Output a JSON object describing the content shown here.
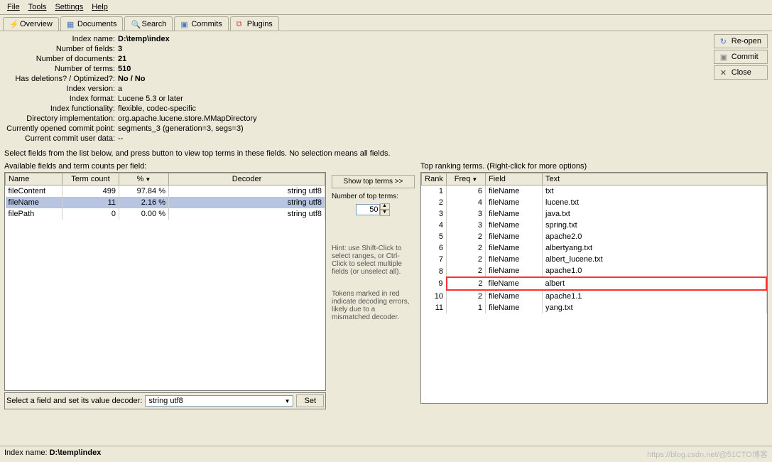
{
  "menu": [
    "File",
    "Tools",
    "Settings",
    "Help"
  ],
  "tabs": [
    {
      "label": "Overview",
      "icon": "lightning-icon",
      "active": true
    },
    {
      "label": "Documents",
      "icon": "documents-icon"
    },
    {
      "label": "Search",
      "icon": "search-icon"
    },
    {
      "label": "Commits",
      "icon": "commits-icon"
    },
    {
      "label": "Plugins",
      "icon": "plugins-icon"
    }
  ],
  "buttons": {
    "reopen": "Re-open",
    "commit": "Commit",
    "close": "Close"
  },
  "info": [
    {
      "label": "Index name:",
      "value": "D:\\temp\\index",
      "bold": true
    },
    {
      "label": "Number of fields:",
      "value": "3",
      "bold": true
    },
    {
      "label": "Number of documents:",
      "value": "21",
      "bold": true
    },
    {
      "label": "Number of terms:",
      "value": "510",
      "bold": true
    },
    {
      "label": "Has deletions? / Optimized?:",
      "value": "No / No",
      "bold": true
    },
    {
      "label": "Index version:",
      "value": "a",
      "bold": false
    },
    {
      "label": "Index format:",
      "value": "Lucene 5.3 or later",
      "bold": false
    },
    {
      "label": "Index functionality:",
      "value": "flexible, codec-specific",
      "bold": false
    },
    {
      "label": "Directory implementation:",
      "value": "org.apache.lucene.store.MMapDirectory",
      "bold": false
    },
    {
      "label": "Currently opened commit point:",
      "value": "segments_3 (generation=3, segs=3)",
      "bold": false
    },
    {
      "label": "Current commit user data:",
      "value": "--",
      "bold": false
    }
  ],
  "instruction": "Select fields from the list below, and press button to view top terms in these fields. No selection means all fields.",
  "leftPanel": {
    "title": "Available fields and term counts per field:",
    "headers": [
      "Name",
      "Term count",
      "%",
      "Decoder"
    ],
    "rows": [
      {
        "name": "fileContent",
        "count": "499",
        "pct": "97.84 %",
        "decoder": "string utf8",
        "selected": false
      },
      {
        "name": "fileName",
        "count": "11",
        "pct": "2.16 %",
        "decoder": "string utf8",
        "selected": true
      },
      {
        "name": "filePath",
        "count": "0",
        "pct": "0.00 %",
        "decoder": "string utf8",
        "selected": false
      }
    ]
  },
  "midPanel": {
    "showBtn": "Show top terms >>",
    "numLabel": "Number of top terms:",
    "numValue": "50",
    "hint1": "Hint: use Shift-Click to select ranges, or Ctrl-Click to select multiple fields (or unselect all).",
    "hint2": "Tokens marked in red indicate decoding errors, likely due to a mismatched decoder."
  },
  "rightPanel": {
    "title": "Top ranking terms. (Right-click for more options)",
    "headers": [
      "Rank",
      "Freq",
      "Field",
      "Text"
    ],
    "rows": [
      {
        "rank": "1",
        "freq": "6",
        "field": "fileName",
        "text": "txt"
      },
      {
        "rank": "2",
        "freq": "4",
        "field": "fileName",
        "text": "lucene.txt"
      },
      {
        "rank": "3",
        "freq": "3",
        "field": "fileName",
        "text": "java.txt"
      },
      {
        "rank": "4",
        "freq": "3",
        "field": "fileName",
        "text": "spring.txt"
      },
      {
        "rank": "5",
        "freq": "2",
        "field": "fileName",
        "text": "apache2.0"
      },
      {
        "rank": "6",
        "freq": "2",
        "field": "fileName",
        "text": "albertyang.txt"
      },
      {
        "rank": "7",
        "freq": "2",
        "field": "fileName",
        "text": "albert_lucene.txt"
      },
      {
        "rank": "8",
        "freq": "2",
        "field": "fileName",
        "text": "apache1.0"
      },
      {
        "rank": "9",
        "freq": "2",
        "field": "fileName",
        "text": "albert",
        "highlight": true
      },
      {
        "rank": "10",
        "freq": "2",
        "field": "fileName",
        "text": "apache1.1"
      },
      {
        "rank": "11",
        "freq": "1",
        "field": "fileName",
        "text": "yang.txt"
      }
    ]
  },
  "decoderBar": {
    "label": "Select a field and set its value decoder:",
    "value": "string utf8",
    "setBtn": "Set"
  },
  "statusbar": {
    "label": "Index name:",
    "value": "D:\\temp\\index",
    "watermark": "https://blog.csdn.net/@51CTO博客"
  }
}
